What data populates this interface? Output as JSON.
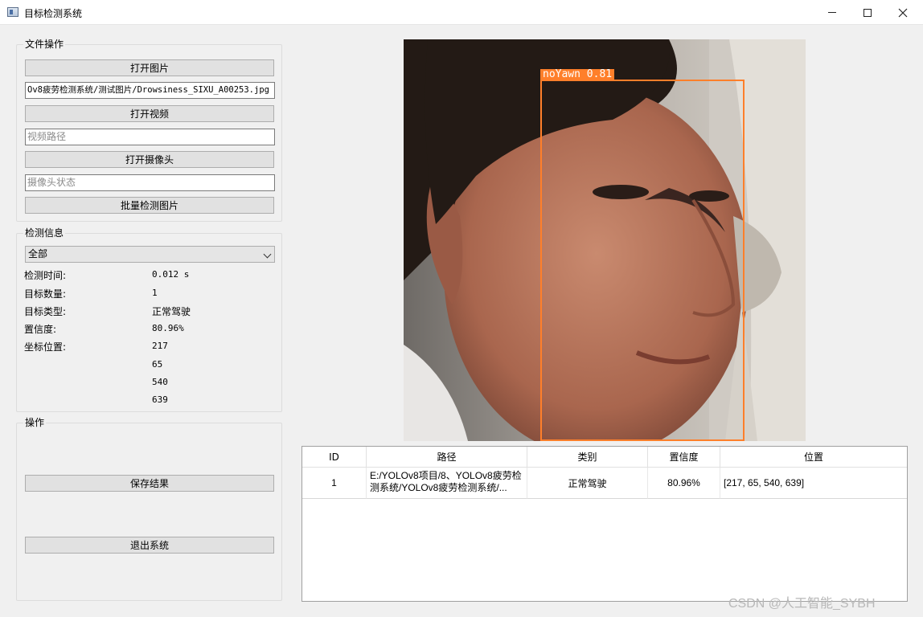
{
  "window": {
    "title": "目标检测系统",
    "icon": "app-window-icon",
    "controls": [
      "minimize-icon",
      "maximize-icon",
      "close-icon"
    ]
  },
  "file_ops": {
    "title": "文件操作",
    "open_image": "打开图片",
    "image_path": "Ov8疲劳检测系统/测试图片/Drowsiness_SIXU_A00253.jpg",
    "open_video": "打开视频",
    "video_placeholder": "视频路径",
    "open_camera": "打开摄像头",
    "camera_placeholder": "摄像头状态",
    "batch_detect": "批量检测图片"
  },
  "detect_info": {
    "title": "检测信息",
    "selected": "全部",
    "time_label": "检测时间:",
    "time_value": "0.012 s",
    "count_label": "目标数量:",
    "count_value": "1",
    "type_label": "目标类型:",
    "type_value": "正常驾驶",
    "conf_label": "置信度:",
    "conf_value": "80.96%",
    "coord_label": "坐标位置:",
    "coords": [
      "217",
      "65",
      "540",
      "639"
    ]
  },
  "operations": {
    "title": "操作",
    "save": "保存结果",
    "exit": "退出系统"
  },
  "detection": {
    "label": "noYawn 0.81",
    "color": "#ff7f2a"
  },
  "table": {
    "headers": [
      "ID",
      "路径",
      "类别",
      "置信度",
      "位置"
    ],
    "rows": [
      {
        "id": "1",
        "path": "E:/YOLOv8项目/8、YOLOv8疲劳检测系统/YOLOv8疲劳检测系统/...",
        "category": "正常驾驶",
        "confidence": "80.96%",
        "position": "[217, 65, 540, 639]"
      }
    ]
  },
  "watermark": "CSDN @人工智能_SYBH"
}
